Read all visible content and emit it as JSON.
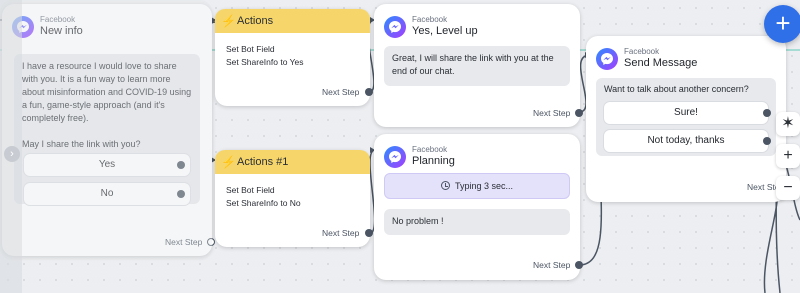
{
  "colors": {
    "accent": "#2f6fe8",
    "action_header": "#f6d66b",
    "typing_bg": "#e4e1fb",
    "link": "#4b5563",
    "link_highlight": "#3fbfa7",
    "background": "#eceef1"
  },
  "icons": {
    "messenger": "messenger-icon",
    "bolt": "lightning-bolt-icon",
    "clock": "clock-icon",
    "add": "plus-icon",
    "magic": "magic-wand-icon",
    "zoom_in": "zoom-in-icon",
    "zoom_out": "zoom-out-icon",
    "collapse": "chevron-right-icon"
  },
  "nodes": {
    "new_info": {
      "channel": "Facebook",
      "title": "New info",
      "message": "I have a resource I would love to share with you. It is a fun way to learn more about misinformation and COVID-19 using a fun, game-style approach (and it's completely free).\n\nMay I share the link with you?",
      "buttons": [
        "Yes",
        "No"
      ],
      "next_step": "Next Step"
    },
    "actions": {
      "title": "Actions",
      "line1": "Set Bot Field",
      "line2": "Set ShareInfo to Yes",
      "next_step": "Next Step"
    },
    "actions_1": {
      "title": "Actions #1",
      "line1": "Set Bot Field",
      "line2": "Set ShareInfo to No",
      "next_step": "Next Step"
    },
    "level_up": {
      "channel": "Facebook",
      "title": "Yes, Level up",
      "message": "Great, I will share the link with you at the end of our chat.",
      "next_step": "Next Step"
    },
    "planning": {
      "channel": "Facebook",
      "title": "Planning",
      "typing": "Typing 3 sec...",
      "message": "No problem !",
      "next_step": "Next Step"
    },
    "send_message": {
      "channel": "Facebook",
      "title": "Send Message",
      "message": "Want to talk about another concern?",
      "buttons": [
        "Sure!",
        "Not today, thanks"
      ],
      "next_step": "Next Step"
    }
  },
  "controls": {
    "add": "+",
    "zoom_in": "+",
    "zoom_out": "−",
    "magic": "✶",
    "collapse": "›"
  }
}
